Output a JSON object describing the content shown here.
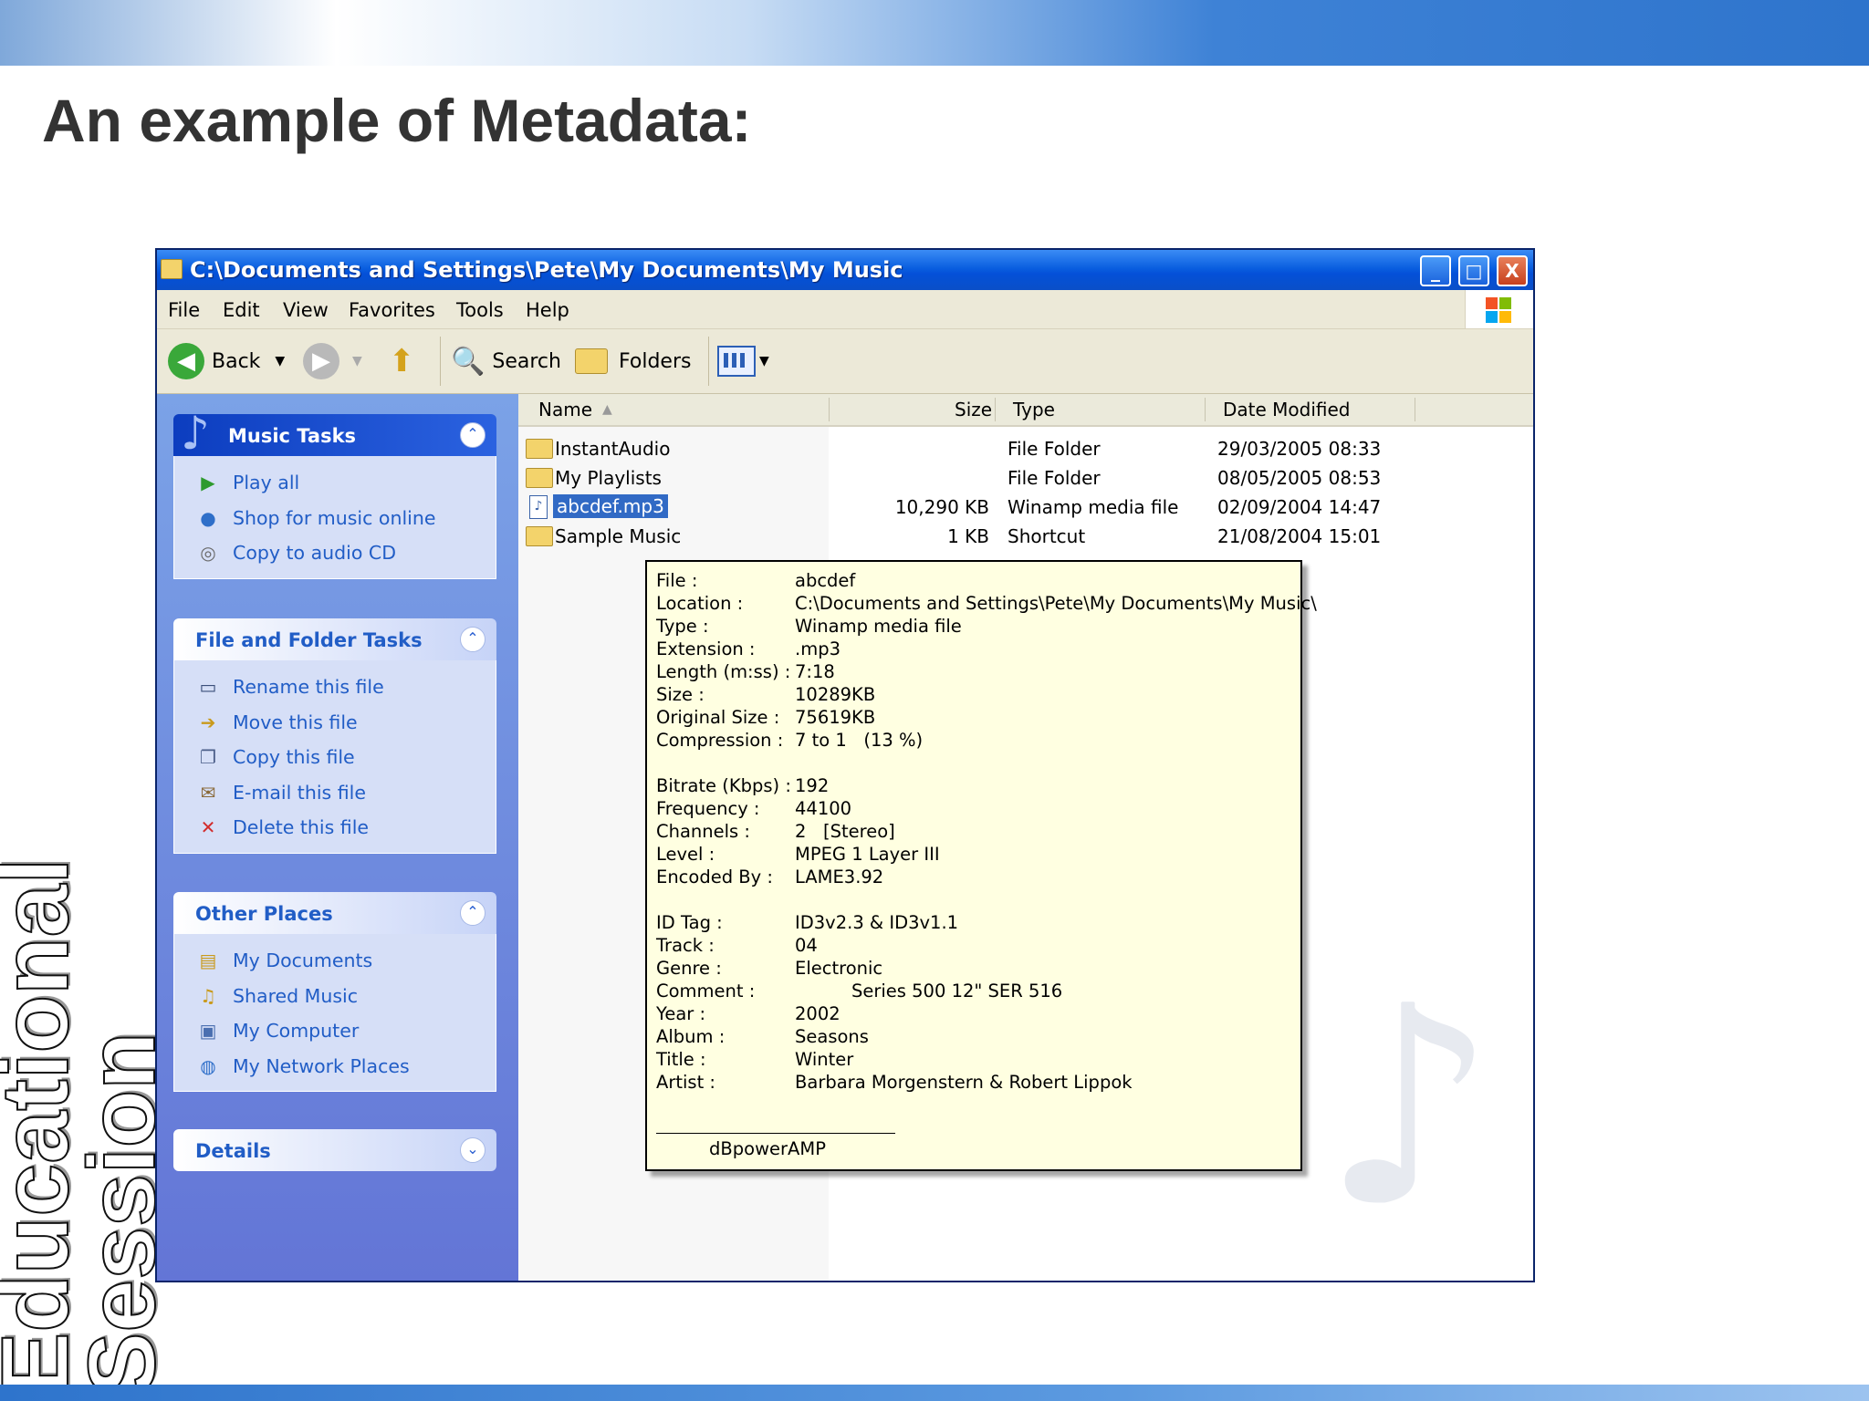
{
  "slide": {
    "title": "An example of Metadata:",
    "vertical_line1": "Educational",
    "vertical_line2": "Session"
  },
  "window": {
    "title": "C:\\Documents and Settings\\Pete\\My Documents\\My Music",
    "buttons": {
      "minimize": "_",
      "maximize": "□",
      "close": "X"
    }
  },
  "menu": [
    "File",
    "Edit",
    "View",
    "Favorites",
    "Tools",
    "Help"
  ],
  "toolbar": {
    "back": "Back",
    "search": "Search",
    "folders": "Folders"
  },
  "taskpane": {
    "music_tasks": {
      "title": "Music Tasks",
      "items": [
        "Play all",
        "Shop for music online",
        "Copy to audio CD"
      ]
    },
    "file_folder_tasks": {
      "title": "File and Folder Tasks",
      "items": [
        "Rename this file",
        "Move this file",
        "Copy this file",
        "E-mail this file",
        "Delete this file"
      ]
    },
    "other_places": {
      "title": "Other Places",
      "items": [
        "My Documents",
        "Shared Music",
        "My Computer",
        "My Network Places"
      ]
    },
    "details": {
      "title": "Details"
    }
  },
  "columns": [
    "Name",
    "Size",
    "Type",
    "Date Modified"
  ],
  "files": [
    {
      "name": "InstantAudio",
      "size": "",
      "type": "File Folder",
      "date": "29/03/2005 08:33"
    },
    {
      "name": "My Playlists",
      "size": "",
      "type": "File Folder",
      "date": "08/05/2005 08:53"
    },
    {
      "name": "abcdef.mp3",
      "size": "10,290 KB",
      "type": "Winamp media file",
      "date": "02/09/2004 14:47"
    },
    {
      "name": "Sample Music",
      "size": "1 KB",
      "type": "Shortcut",
      "date": "21/08/2004 15:01"
    }
  ],
  "tooltip": {
    "rows": [
      {
        "k": "File :",
        "v": "abcdef"
      },
      {
        "k": "Location :",
        "v": "C:\\Documents and Settings\\Pete\\My Documents\\My Music\\"
      },
      {
        "k": "Type :",
        "v": "Winamp media file"
      },
      {
        "k": "Extension :",
        "v": ".mp3"
      },
      {
        "k": "Length (m:ss) :",
        "v": "7:18"
      },
      {
        "k": "Size :",
        "v": "10289KB"
      },
      {
        "k": "Original Size :",
        "v": "75619KB"
      },
      {
        "k": "Compression :",
        "v": "7 to 1   (13 %)"
      },
      {
        "k": "Bitrate (Kbps) :",
        "v": "192"
      },
      {
        "k": "Frequency :",
        "v": "44100"
      },
      {
        "k": "Channels :",
        "v": "2   [Stereo]"
      },
      {
        "k": "Level :",
        "v": "MPEG 1 Layer III"
      },
      {
        "k": "Encoded By :",
        "v": "LAME3.92"
      },
      {
        "k": "ID Tag :",
        "v": "ID3v2.3 & ID3v1.1"
      },
      {
        "k": "Track :",
        "v": "04"
      },
      {
        "k": "Genre :",
        "v": "Electronic"
      },
      {
        "k": "Comment :",
        "v": "          Series 500 12\" SER 516"
      },
      {
        "k": "Year :",
        "v": "2002"
      },
      {
        "k": "Album :",
        "v": "Seasons"
      },
      {
        "k": "Title :",
        "v": "Winter"
      },
      {
        "k": "Artist :",
        "v": "Barbara Morgenstern & Robert Lippok"
      }
    ],
    "footer": "dBpowerAMP"
  },
  "colors": {
    "titlebar": "#0a5fe0",
    "selection": "#316ac5",
    "task_link": "#215dc6",
    "tooltip_bg": "#ffffe1"
  }
}
